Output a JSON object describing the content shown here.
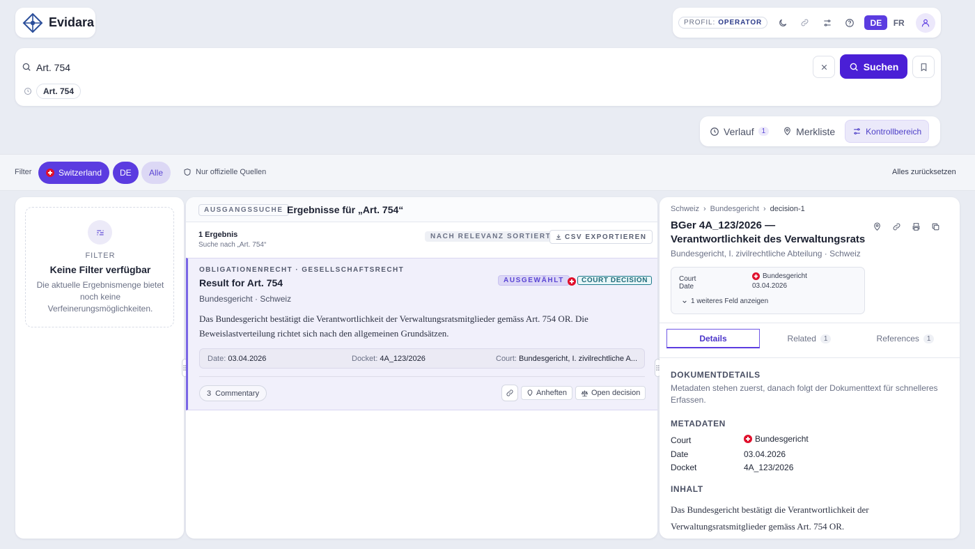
{
  "app": {
    "name": "Evidara"
  },
  "topbar": {
    "profile_label": "PROFIL:",
    "profile_value": "OPERATOR",
    "icons": [
      "moon-icon",
      "link-icon",
      "sliders-icon",
      "help-icon"
    ],
    "languages": [
      {
        "code": "DE",
        "active": true
      },
      {
        "code": "FR",
        "active": false
      }
    ],
    "accent": "#5b3ce0"
  },
  "search": {
    "query": "Art. 754",
    "button_label": "Suchen",
    "history": [
      "Art. 754"
    ]
  },
  "view_tabs": [
    {
      "label": "Verlauf",
      "count": "1",
      "icon": "clock-icon"
    },
    {
      "label": "Merkliste",
      "icon": "pin-icon"
    },
    {
      "label": "Kontrollbereich",
      "icon": "sliders-icon",
      "active": true
    }
  ],
  "filterbar": {
    "label": "Filter",
    "country": "Switzerland",
    "language": "DE",
    "scope": "Alle",
    "official_only": "Nur offizielle Quellen",
    "reset": "Alles zurücksetzen"
  },
  "left_panel": {
    "eyebrow": "FILTER",
    "title": "Keine Filter verfügbar",
    "body": "Die aktuelle Ergebnismenge bietet noch keine Verfeinerungsmöglichkeiten."
  },
  "results": {
    "mode_badge": "AUSGANGSSUCHE",
    "title": "Ergebnisse für „Art. 754“",
    "count": "1 Ergebnis",
    "subtitle": "Suche nach „Art. 754“",
    "sort_label": "NACH RELEVANZ SORTIERT",
    "export_label": "CSV EXPORTIEREN",
    "items": [
      {
        "category": "OBLIGATIONENRECHT · GESELLSCHAFTSRECHT",
        "title": "Result for Art. 754",
        "selected_label": "AUSGEWÄHLT",
        "type_label": "COURT DECISION",
        "source": "Bundesgericht · Schweiz",
        "snippet": "Das Bundesgericht bestätigt die Verantwortlichkeit der Verwaltungsratsmitglieder gemäss Art. 754 OR. Die Beweislastverteilung richtet sich nach den allgemeinen Grundsätzen.",
        "meta": [
          {
            "label": "Date:",
            "value": "03.04.2026"
          },
          {
            "label": "Docket:",
            "value": "4A_123/2026"
          },
          {
            "label": "Court:",
            "value": "Bundesgericht, I. zivilrechtliche A..."
          }
        ],
        "commentary_count": "3",
        "commentary_label": "Commentary",
        "pin_label": "Anheften",
        "open_label": "Open decision"
      }
    ]
  },
  "detail": {
    "breadcrumb": [
      "Schweiz",
      "Bundesgericht",
      "decision-1"
    ],
    "title": "BGer 4A_123/2026 — Verantwortlichkeit des Verwaltungsrats",
    "subtitle": "Bundesgericht, I. zivilrechtliche Abteilung · Schweiz",
    "summary": [
      {
        "label": "Court",
        "value": "Bundesgericht"
      },
      {
        "label": "Date",
        "value": "03.04.2026"
      }
    ],
    "more_fields": "1 weiteres Feld anzeigen",
    "tabs": [
      {
        "label": "Details",
        "active": true
      },
      {
        "label": "Related",
        "count": "1"
      },
      {
        "label": "References",
        "count": "1"
      }
    ],
    "doc_section": "DOKUMENTDETAILS",
    "doc_note": "Metadaten stehen zuerst, danach folgt der Dokumenttext für schnelleres Erfassen.",
    "meta_section": "METADATEN",
    "metadata": [
      {
        "label": "Court",
        "value": "Bundesgericht"
      },
      {
        "label": "Date",
        "value": "03.04.2026"
      },
      {
        "label": "Docket",
        "value": "4A_123/2026"
      }
    ],
    "content_section": "INHALT",
    "content": "Das Bundesgericht bestätigt die Verantwortlichkeit der Verwaltungsratsmitglieder gemäss Art. 754 OR."
  }
}
